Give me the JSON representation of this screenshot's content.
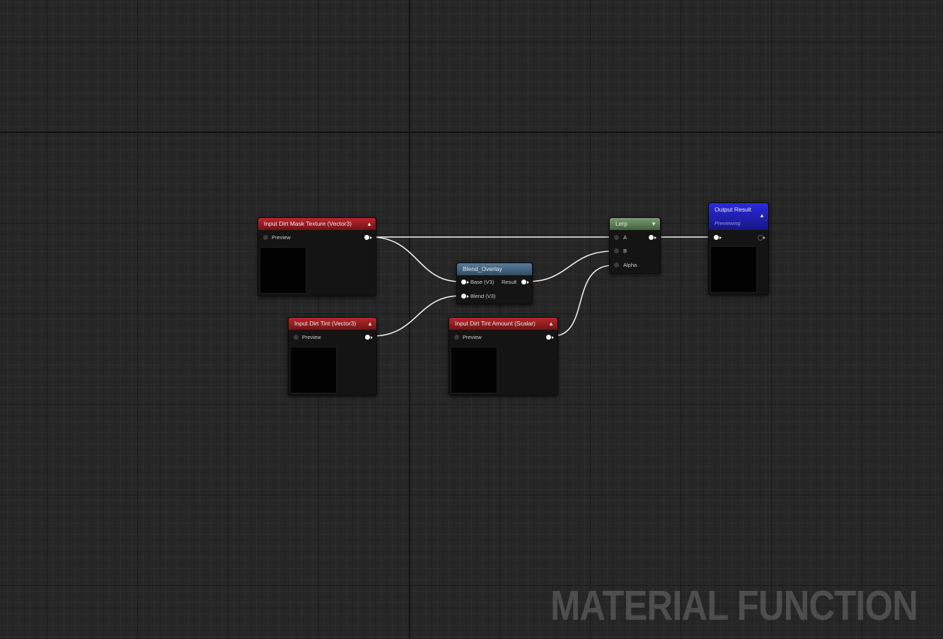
{
  "graph": {
    "nodes": {
      "dirt_mask": {
        "title": "Input Dirt Mask Texture (Vector3)",
        "collapse_icon": "chevron-up-icon",
        "pin_label": "Preview"
      },
      "dirt_tint": {
        "title": "Input Dirt Tint (Vector3)",
        "collapse_icon": "chevron-up-icon",
        "pin_label": "Preview"
      },
      "dirt_tint_amount": {
        "title": "Input Dirt Tint Amount (Scalar)",
        "collapse_icon": "chevron-up-icon",
        "pin_label": "Preview"
      },
      "blend_overlay": {
        "title": "Blend_Overlay",
        "inputs": [
          "Base (V3)",
          "Blend (V3)"
        ],
        "output": "Result"
      },
      "lerp": {
        "title": "Lerp",
        "collapse_icon": "chevron-down-icon",
        "inputs": [
          "A",
          "B",
          "Alpha"
        ]
      },
      "output_result": {
        "title": "Output Result",
        "status": "Previewing",
        "collapse_icon": "chevron-up-icon"
      }
    },
    "colors": {
      "input_header": "#b8282c",
      "function_header": "#5a7c99",
      "lerp_header": "#7a9a72",
      "output_header": "#2a2ae0",
      "wire": "#f0f0f0",
      "background": "#262626"
    }
  },
  "watermark": "MATERIAL FUNCTION"
}
